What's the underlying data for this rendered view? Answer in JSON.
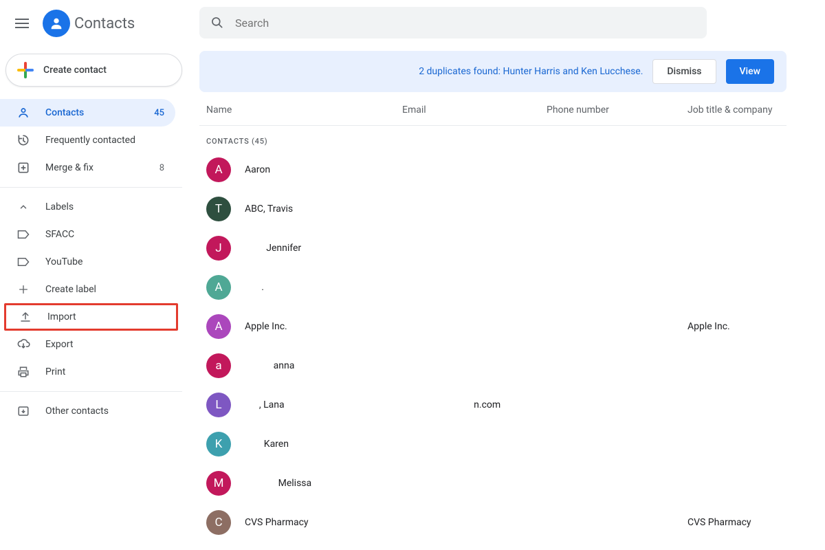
{
  "app_title": "Contacts",
  "create_label": "Create contact",
  "search_placeholder": "Search",
  "nav": {
    "contacts": {
      "label": "Contacts",
      "count": "45"
    },
    "frequent": {
      "label": "Frequently contacted"
    },
    "merge": {
      "label": "Merge & fix",
      "count": "8"
    },
    "labels_header": "Labels",
    "label_items": [
      {
        "label": "SFACC"
      },
      {
        "label": "YouTube"
      }
    ],
    "create_label": "Create label",
    "import": "Import",
    "export": "Export",
    "print": "Print",
    "other": "Other contacts"
  },
  "banner": {
    "text": "2 duplicates found: Hunter Harris and Ken Lucchese.",
    "dismiss": "Dismiss",
    "view": "View"
  },
  "columns": {
    "name": "Name",
    "email": "Email",
    "phone": "Phone number",
    "job": "Job title & company"
  },
  "group_label": "Contacts (45)",
  "contacts": [
    {
      "initial": "A",
      "color": "#c2185b",
      "name": "Aaron",
      "email": "",
      "phone": "",
      "company": ""
    },
    {
      "initial": "T",
      "color": "#2e4f3f",
      "name": "ABC, Travis",
      "email": "",
      "phone": "",
      "company": ""
    },
    {
      "initial": "J",
      "color": "#c2185b",
      "name": "         Jennifer",
      "email": "",
      "phone": "",
      "company": ""
    },
    {
      "initial": "A",
      "color": "#4fa895",
      "name": "       .",
      "email": "",
      "phone": "",
      "company": ""
    },
    {
      "initial": "A",
      "color": "#ab47bc",
      "name": "Apple Inc.",
      "email": "",
      "phone": "",
      "company": "Apple Inc."
    },
    {
      "initial": "a",
      "color": "#c2185b",
      "name": "            anna",
      "email": "",
      "phone": "",
      "company": ""
    },
    {
      "initial": "L",
      "color": "#7e57c2",
      "name": "      , Lana",
      "email": "                              n.com",
      "phone": "",
      "company": ""
    },
    {
      "initial": "K",
      "color": "#3da0ae",
      "name": "        Karen",
      "email": "",
      "phone": "",
      "company": ""
    },
    {
      "initial": "M",
      "color": "#c2185b",
      "name": "              Melissa",
      "email": "",
      "phone": "",
      "company": ""
    },
    {
      "initial": "C",
      "color": "#8d6e63",
      "name": "CVS Pharmacy",
      "email": "",
      "phone": "",
      "company": "CVS Pharmacy"
    }
  ]
}
